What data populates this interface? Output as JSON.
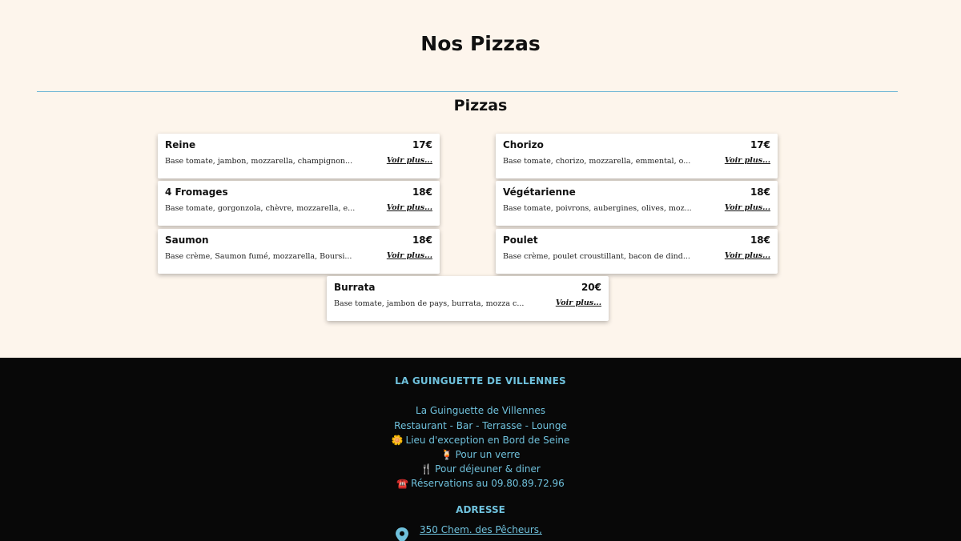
{
  "page": {
    "title": "Nos Pizzas",
    "section_title": "Pizzas"
  },
  "pizzas": [
    {
      "name": "Reine",
      "price": "17€",
      "desc": "Base tomate, jambon, mozzarella, champignon...",
      "more": "Voir plus..."
    },
    {
      "name": "Chorizo",
      "price": "17€",
      "desc": "Base tomate, chorizo, mozzarella, emmental, o...",
      "more": "Voir plus..."
    },
    {
      "name": "4 Fromages",
      "price": "18€",
      "desc": "Base tomate, gorgonzola, chèvre, mozzarella, e...",
      "more": "Voir plus..."
    },
    {
      "name": "Végétarienne",
      "price": "18€",
      "desc": "Base tomate, poivrons, aubergines, olives, moz...",
      "more": "Voir plus..."
    },
    {
      "name": "Saumon",
      "price": "18€",
      "desc": "Base crème, Saumon fumé, mozzarella, Boursi...",
      "more": "Voir plus..."
    },
    {
      "name": "Poulet",
      "price": "18€",
      "desc": "Base crème, poulet croustillant, bacon de dind...",
      "more": "Voir plus..."
    },
    {
      "name": "Burrata",
      "price": "20€",
      "desc": "Base tomate, jambon de pays, burrata, mozza c...",
      "more": "Voir plus..."
    }
  ],
  "footer": {
    "title": "LA GUINGUETTE DE VILLENNES",
    "lines": [
      {
        "icon": "",
        "text": "La Guinguette de Villennes"
      },
      {
        "icon": "",
        "text": "Restaurant - Bar - Terrasse - Lounge"
      },
      {
        "icon": "🌼",
        "icon_name": "flower-icon",
        "text": "Lieu d'exception en Bord de Seine"
      },
      {
        "icon": "🍹",
        "icon_name": "cocktail-icon",
        "text": "Pour un verre"
      },
      {
        "icon": "🍴",
        "icon_name": "fork-knife-icon",
        "text": "Pour déjeuner & diner"
      },
      {
        "icon": "☎️",
        "icon_name": "telephone-icon",
        "text": "Réservations au 09.80.89.72.96"
      }
    ],
    "address_title": "ADRESSE",
    "address_link": "350 Chem. des Pêcheurs,"
  },
  "colors": {
    "background": "#fdf5ec",
    "accent": "#6fc1dc",
    "footer_bg": "#080808",
    "divider": "#6fb6d6"
  }
}
